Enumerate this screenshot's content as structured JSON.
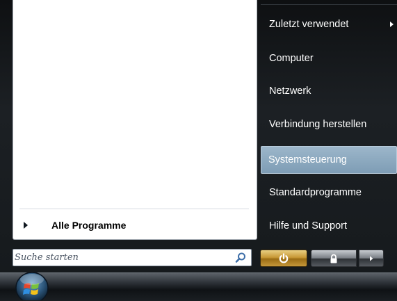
{
  "start_menu": {
    "left": {
      "all_programs_label": "Alle Programme",
      "search_placeholder": "Suche starten"
    },
    "right": {
      "items": [
        {
          "label": "Zuletzt verwendet",
          "has_submenu": true
        },
        {
          "label": "Computer"
        },
        {
          "label": "Netzwerk"
        },
        {
          "label": "Verbindung herstellen"
        },
        {
          "label": "Systemsteuerung",
          "highlighted": true
        },
        {
          "label": "Standardprogramme"
        },
        {
          "label": "Hilfe und Support"
        }
      ]
    },
    "power_buttons": {
      "power_icon": "power-icon",
      "lock_icon": "lock-icon",
      "more_icon": "arrow-right-icon"
    }
  },
  "colors": {
    "highlight": "#8fabc1",
    "power_button": "#c79835",
    "menu_background": "#161a1d"
  }
}
